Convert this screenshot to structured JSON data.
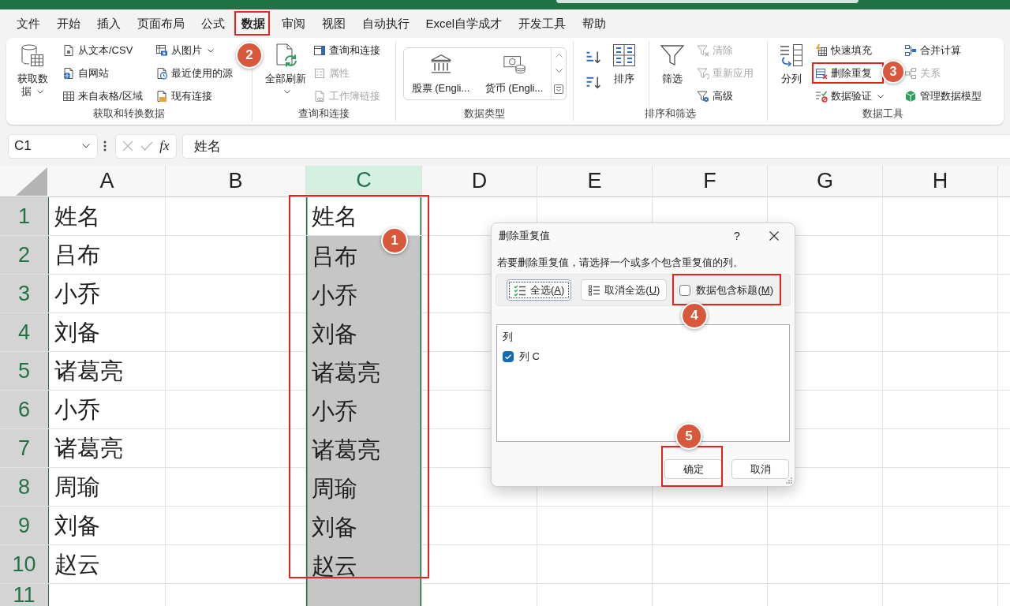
{
  "menu_tabs": [
    {
      "label": "文件",
      "selected": false
    },
    {
      "label": "开始",
      "selected": false
    },
    {
      "label": "插入",
      "selected": false
    },
    {
      "label": "页面布局",
      "selected": false
    },
    {
      "label": "公式",
      "selected": false
    },
    {
      "label": "数据",
      "selected": true
    },
    {
      "label": "审阅",
      "selected": false
    },
    {
      "label": "视图",
      "selected": false
    },
    {
      "label": "自动执行",
      "selected": false
    },
    {
      "label": "Excel自学成才",
      "selected": false
    },
    {
      "label": "开发工具",
      "selected": false
    },
    {
      "label": "帮助",
      "selected": false
    }
  ],
  "ribbon": {
    "groups": [
      {
        "label": "获取和转换数据",
        "kind": "buttons",
        "columns": [
          [
            {
              "kind": "large",
              "label": "获取数据",
              "dropdown": true,
              "disabled": false
            }
          ],
          [
            {
              "kind": "small",
              "label": "从文本/CSV",
              "dropdown": false,
              "disabled": false
            },
            {
              "kind": "small",
              "label": "自网站",
              "dropdown": false,
              "disabled": false
            },
            {
              "kind": "small",
              "label": "来自表格/区域",
              "dropdown": false,
              "disabled": false
            }
          ],
          [
            {
              "kind": "small",
              "label": "从图片",
              "dropdown": true,
              "disabled": false
            },
            {
              "kind": "small",
              "label": "最近使用的源",
              "dropdown": false,
              "disabled": false
            },
            {
              "kind": "small",
              "label": "现有连接",
              "dropdown": false,
              "disabled": false
            }
          ]
        ]
      },
      {
        "label": "查询和连接",
        "kind": "buttons",
        "columns": [
          [
            {
              "kind": "large",
              "label": "全部刷新",
              "dropdown": true,
              "disabled": false
            }
          ],
          [
            {
              "kind": "small",
              "label": "查询和连接",
              "dropdown": false,
              "disabled": false
            },
            {
              "kind": "small",
              "label": "属性",
              "dropdown": false,
              "disabled": true
            },
            {
              "kind": "small",
              "label": "工作簿链接",
              "dropdown": false,
              "disabled": true
            }
          ]
        ]
      },
      {
        "label": "数据类型",
        "kind": "gallery",
        "columns": [
          [
            {
              "kind": "gallery",
              "label": "股票 (Engli...",
              "dropdown": false,
              "disabled": false
            }
          ],
          [
            {
              "kind": "gallery",
              "label": "货币 (Engli...",
              "dropdown": false,
              "disabled": false
            }
          ]
        ]
      },
      {
        "label": "排序和筛选",
        "kind": "buttons",
        "columns": [
          [
            {
              "kind": "icon",
              "dropdown": false,
              "disabled": false
            },
            {
              "kind": "icon",
              "dropdown": false,
              "disabled": false
            }
          ],
          [
            {
              "kind": "large",
              "label": "排序",
              "dropdown": false,
              "disabled": false
            }
          ],
          [
            {
              "kind": "large",
              "label": "筛选",
              "dropdown": false,
              "disabled": false
            }
          ],
          [
            {
              "kind": "small",
              "label": "清除",
              "dropdown": false,
              "disabled": true
            },
            {
              "kind": "small",
              "label": "重新应用",
              "dropdown": false,
              "disabled": true
            },
            {
              "kind": "small",
              "label": "高级",
              "dropdown": false,
              "disabled": false
            }
          ]
        ]
      },
      {
        "label": "数据工具",
        "kind": "buttons",
        "columns": [
          [
            {
              "kind": "large",
              "label": "分列",
              "dropdown": false,
              "disabled": false
            }
          ],
          [
            {
              "kind": "small",
              "label": "快速填充",
              "dropdown": false,
              "disabled": false
            },
            {
              "kind": "small",
              "label": "删除重复",
              "dropdown": false,
              "disabled": false
            },
            {
              "kind": "small",
              "label": "数据验证",
              "dropdown": true,
              "disabled": false
            }
          ],
          [
            {
              "kind": "small",
              "label": "合并计算",
              "dropdown": false,
              "disabled": false
            },
            {
              "kind": "small",
              "label": "关系",
              "dropdown": false,
              "disabled": true
            },
            {
              "kind": "small",
              "label": "管理数据模型",
              "dropdown": false,
              "disabled": false
            }
          ]
        ]
      }
    ]
  },
  "formula_bar": {
    "name_box": "C1",
    "function_label": "fx",
    "formula": "姓名"
  },
  "sheet": {
    "columns": [
      {
        "label": "A",
        "selected": false
      },
      {
        "label": "B",
        "selected": false
      },
      {
        "label": "C",
        "selected": true
      },
      {
        "label": "D",
        "selected": false
      },
      {
        "label": "E",
        "selected": false
      },
      {
        "label": "F",
        "selected": false
      },
      {
        "label": "G",
        "selected": false
      },
      {
        "label": "H",
        "selected": false
      }
    ],
    "rows": [
      {
        "number": "1",
        "selected": true,
        "active": true,
        "column_a": "姓名",
        "column_c": "姓名"
      },
      {
        "number": "2",
        "selected": true,
        "active": false,
        "column_a": "吕布",
        "column_c": "吕布"
      },
      {
        "number": "3",
        "selected": true,
        "active": false,
        "column_a": "小乔",
        "column_c": "小乔"
      },
      {
        "number": "4",
        "selected": true,
        "active": false,
        "column_a": "刘备",
        "column_c": "刘备"
      },
      {
        "number": "5",
        "selected": true,
        "active": false,
        "column_a": "诸葛亮",
        "column_c": "诸葛亮"
      },
      {
        "number": "6",
        "selected": true,
        "active": false,
        "column_a": "小乔",
        "column_c": "小乔"
      },
      {
        "number": "7",
        "selected": true,
        "active": false,
        "column_a": "诸葛亮",
        "column_c": "诸葛亮"
      },
      {
        "number": "8",
        "selected": true,
        "active": false,
        "column_a": "周瑜",
        "column_c": "周瑜"
      },
      {
        "number": "9",
        "selected": true,
        "active": false,
        "column_a": "刘备",
        "column_c": "刘备"
      },
      {
        "number": "10",
        "selected": true,
        "active": false,
        "column_a": "赵云",
        "column_c": "赵云"
      },
      {
        "number": "11",
        "selected": true,
        "active": false
      }
    ]
  },
  "dialog": {
    "title": "删除重复值",
    "help_button": "?",
    "instruction": "若要删除重复值，请选择一个或多个包含重复值的列。",
    "toolbar_buttons": [
      {
        "label_pre": "全选(",
        "mnemonic": "A",
        "label_post": ")",
        "focused": true
      },
      {
        "label_pre": "取消全选(",
        "mnemonic": "U",
        "label_post": ")",
        "focused": false
      }
    ],
    "header_checkbox": {
      "label_pre": "数据包含标题(",
      "mnemonic": "M",
      "label_post": ")",
      "checked": false
    },
    "list": {
      "heading": "列",
      "items": [
        {
          "label": "列 C",
          "checked": true
        }
      ]
    },
    "buttons": [
      {
        "label": "确定"
      },
      {
        "label": "取消"
      }
    ]
  },
  "callouts": [
    {
      "number": "1"
    },
    {
      "number": "2"
    },
    {
      "number": "3"
    },
    {
      "number": "4"
    },
    {
      "number": "5"
    }
  ]
}
